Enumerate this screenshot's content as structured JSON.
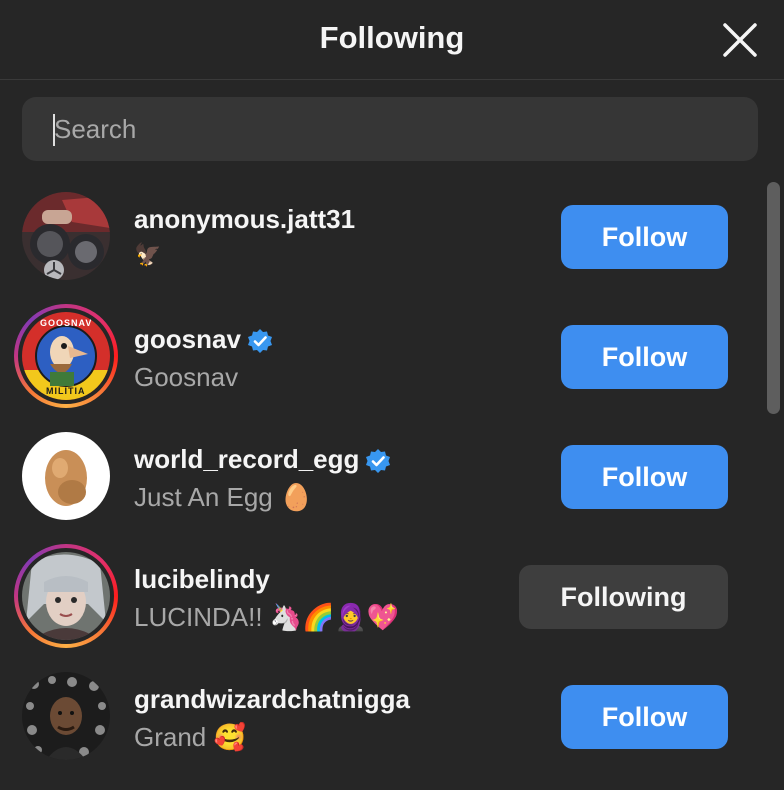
{
  "header": {
    "title": "Following",
    "close_icon": "close-icon"
  },
  "search": {
    "placeholder": "Search",
    "value": ""
  },
  "accounts": [
    {
      "username": "anonymous.jatt31",
      "subtitle": "🦅",
      "verified": false,
      "button": "Follow",
      "avatar_ring": false
    },
    {
      "username": "goosnav",
      "subtitle": "Goosnav",
      "verified": true,
      "button": "Follow",
      "avatar_ring": true,
      "avatar_text_top": "GOOSNAV",
      "avatar_text_bottom": "MILITIA"
    },
    {
      "username": "world_record_egg",
      "subtitle": "Just An Egg 🥚",
      "verified": true,
      "button": "Follow",
      "avatar_ring": false
    },
    {
      "username": "lucibelindy",
      "subtitle": "LUCINDA!! 🦄🌈🧕💖",
      "verified": false,
      "button": "Following",
      "avatar_ring": true
    },
    {
      "username": "grandwizardchatnigga",
      "subtitle": "Grand 🥰",
      "verified": false,
      "button": "Follow",
      "avatar_ring": false
    }
  ],
  "colors": {
    "background": "#262626",
    "follow_button": "#3e8ef0",
    "following_button": "#3e3e3e",
    "verified_badge": "#3897f0",
    "subtitle_text": "#a8a8a8"
  }
}
